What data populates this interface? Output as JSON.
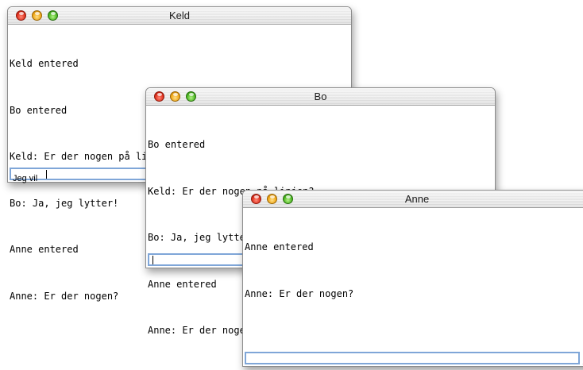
{
  "windows": [
    {
      "title": "Keld",
      "lines": [
        "Keld entered",
        "Bo entered",
        "Keld: Er der nogen på linjen?",
        "Bo: Ja, jeg lytter!",
        "Anne entered",
        "Anne: Er der nogen?"
      ],
      "input_value": "Jeg vil"
    },
    {
      "title": "Bo",
      "lines": [
        "Bo entered",
        "Keld: Er der nogen på linjen?",
        "Bo: Ja, jeg lytter!",
        "Anne entered",
        "Anne: Er der nogen?"
      ],
      "input_value": ""
    },
    {
      "title": "Anne",
      "lines": [
        "Anne entered",
        "Anne: Er der nogen?"
      ],
      "input_value": ""
    }
  ],
  "colors": {
    "close_button": "#e0321e",
    "minimize_button": "#f0a818",
    "zoom_button": "#4db822",
    "input_focus_border": "#7fa6d8"
  },
  "icons": [
    "close-icon",
    "minimize-icon",
    "zoom-icon",
    "resize-grip-icon"
  ]
}
